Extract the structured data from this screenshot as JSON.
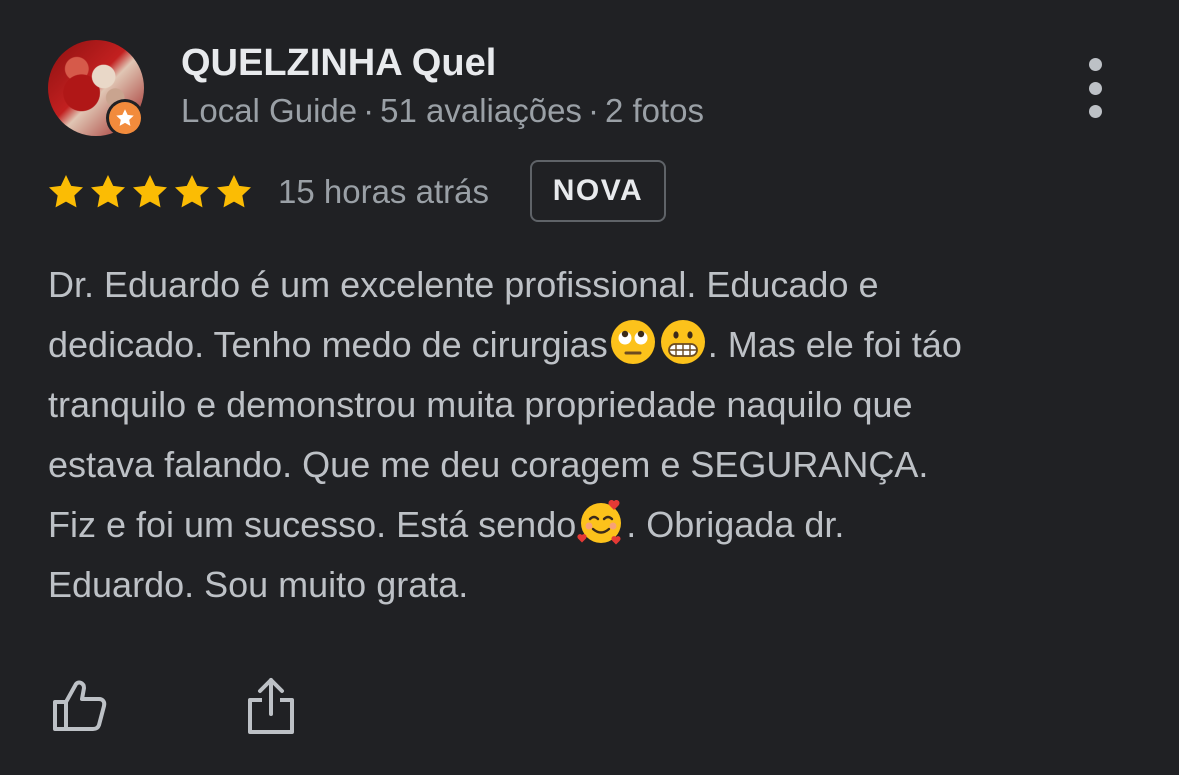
{
  "author": {
    "name": "QUELZINHA Quel",
    "badge": "Local Guide",
    "reviews_count": "51 avaliações",
    "photos_count": "2 fotos",
    "separator": "·"
  },
  "rating": {
    "stars": 5,
    "max": 5,
    "star_color": "#fbbc04"
  },
  "time_ago": "15 horas atrás",
  "new_badge": "NOVA",
  "review_lines": [
    {
      "text": "Dr. Eduardo é um excelente profissional. Educado e"
    },
    {
      "before": "dedicado. Tenho medo de cirurgias",
      "emoji": [
        "face-with-rolling-eyes",
        "grimacing-face"
      ],
      "after": ". Mas ele foi táo"
    },
    {
      "text": "tranquilo e demonstrou muita propriedade naquilo que"
    },
    {
      "text": "estava falando. Que me deu coragem e SEGURANÇA."
    },
    {
      "before": "Fiz e foi um sucesso. Está sendo",
      "emoji": [
        "smiling-face-with-hearts"
      ],
      "after": ". Obrigada dr."
    },
    {
      "text": "Eduardo. Sou muito grata."
    }
  ],
  "actions": {
    "like_icon": "thumbs-up-icon",
    "share_icon": "share-icon",
    "more_icon": "more-vert-icon"
  },
  "colors": {
    "background": "#202124",
    "primary_text": "#e8eaed",
    "secondary_text": "#9aa0a6",
    "body_text": "#bdc1c6",
    "guide_badge": "#f28b3c"
  }
}
